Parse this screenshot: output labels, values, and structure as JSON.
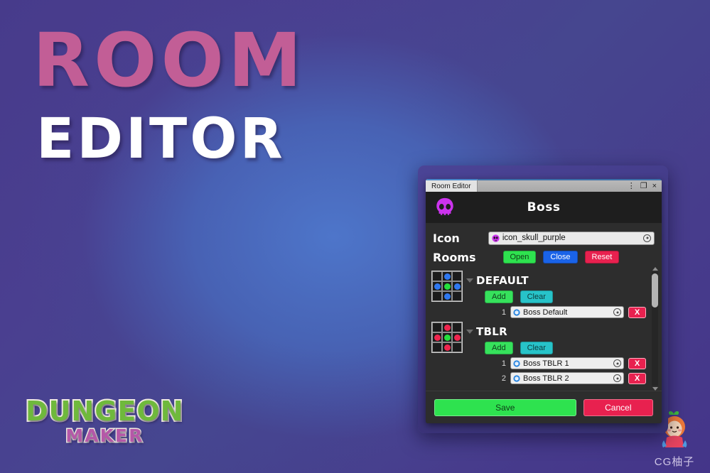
{
  "promo": {
    "line1": "ROOM",
    "line2": "EDITOR",
    "color_pink": "#c25e96",
    "color_white": "#ffffff"
  },
  "logo": {
    "line1": "DUNGEON",
    "line2": "MAKER",
    "green": "#6fb93c",
    "purple": "#b558a8"
  },
  "watermark": {
    "text": "CG柚子"
  },
  "window": {
    "tab_label": "Room Editor",
    "controls": {
      "menu": "⋮",
      "maximize": "❐",
      "close": "×"
    }
  },
  "header": {
    "title": "Boss",
    "icon": "skull-purple-icon",
    "icon_color": "#cc33ee"
  },
  "fields": {
    "icon_label": "Icon",
    "icon_value": "icon_skull_purple",
    "icon_picker": "object-picker-icon"
  },
  "rooms": {
    "label": "Rooms",
    "actions": [
      {
        "label": "Open",
        "color": "#2ee24f"
      },
      {
        "label": "Close",
        "color": "#1a63e8"
      },
      {
        "label": "Reset",
        "color": "#e8214f"
      }
    ],
    "groups": [
      {
        "name": "DEFAULT",
        "dot_color": "#2f78f0",
        "center_color": "#25e03c",
        "grid": [
          "",
          "blue",
          "",
          "blue",
          "green",
          "blue",
          "",
          "blue",
          ""
        ],
        "add_label": "Add",
        "clear_label": "Clear",
        "items": [
          {
            "index": "1",
            "value": "Boss Default",
            "remove_label": "X"
          }
        ]
      },
      {
        "name": "TBLR",
        "dot_color": "#f0264e",
        "center_color": "#25e03c",
        "grid": [
          "",
          "red",
          "",
          "red",
          "green",
          "red",
          "",
          "red",
          ""
        ],
        "add_label": "Add",
        "clear_label": "Clear",
        "items": [
          {
            "index": "1",
            "value": "Boss TBLR 1",
            "remove_label": "X"
          },
          {
            "index": "2",
            "value": "Boss TBLR 2",
            "remove_label": "X"
          }
        ]
      }
    ]
  },
  "footer": {
    "save_label": "Save",
    "cancel_label": "Cancel",
    "save_color": "#2ee24f",
    "cancel_color": "#e8214f"
  }
}
